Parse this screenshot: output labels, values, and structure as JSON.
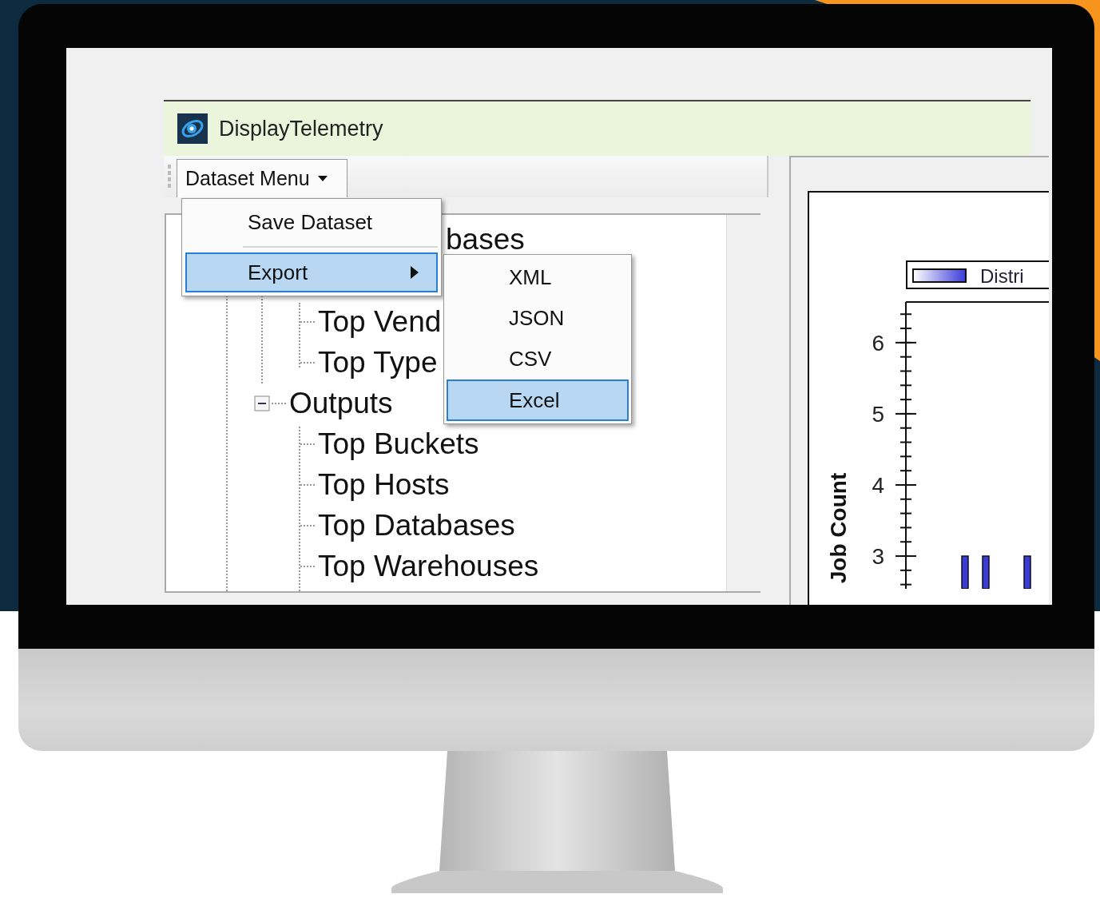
{
  "window": {
    "title": "DisplayTelemetry"
  },
  "toolbar": {
    "menu_button": "Dataset Menu"
  },
  "tree": {
    "items": [
      {
        "label": "bases",
        "kind": "partial",
        "children": [
          {
            "label": "Top Vend"
          },
          {
            "label": "Top Type"
          }
        ]
      },
      {
        "label": "Outputs",
        "kind": "node",
        "expanded": true,
        "children": [
          {
            "label": "Top Buckets"
          },
          {
            "label": "Top Hosts"
          },
          {
            "label": "Top Databases"
          },
          {
            "label": "Top Warehouses"
          }
        ]
      }
    ]
  },
  "dropdown_menu": {
    "items": [
      {
        "label": "Save Dataset",
        "selected": false,
        "has_submenu": false
      },
      {
        "label": "Export",
        "selected": true,
        "has_submenu": true
      }
    ]
  },
  "submenu": {
    "items": [
      {
        "label": "XML",
        "selected": false
      },
      {
        "label": "JSON",
        "selected": false
      },
      {
        "label": "CSV",
        "selected": false
      },
      {
        "label": "Excel",
        "selected": true
      }
    ]
  },
  "chart": {
    "chart_data": {
      "type": "bar",
      "ylabel": "Job Count",
      "ylim": [
        2.54,
        6.56
      ],
      "yticks": [
        3,
        4,
        5,
        6
      ],
      "series": [
        {
          "name": "Distri",
          "color": "#3b3bd9",
          "values": [
            3,
            3,
            3
          ]
        }
      ]
    }
  }
}
